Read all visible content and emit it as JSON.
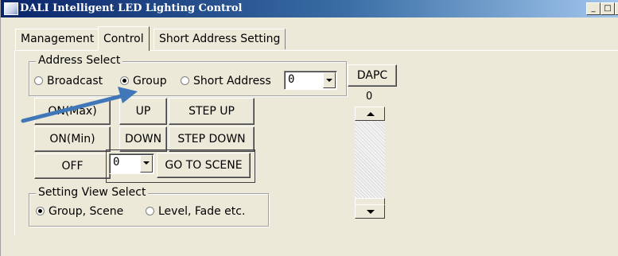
{
  "window": {
    "title": "DALI Intelligent LED Lighting Control",
    "controls": {
      "minimize": "_",
      "maximize": "□",
      "close": "×"
    }
  },
  "tabs": [
    {
      "label": "Management",
      "active": false
    },
    {
      "label": "Control",
      "active": true
    },
    {
      "label": "Short Address Setting",
      "active": false
    }
  ],
  "address_select": {
    "label": "Address Select",
    "options": [
      {
        "label": "Broadcast",
        "selected": false
      },
      {
        "label": "Group",
        "selected": true
      },
      {
        "label": "Short Address",
        "selected": false
      }
    ],
    "short_address_value": "0"
  },
  "dapc": {
    "button_label": "DAPC",
    "value": "0"
  },
  "buttons": {
    "on_max": "ON(Max)",
    "on_min": "ON(Min)",
    "off": "OFF",
    "up": "UP",
    "down": "DOWN",
    "step_up": "STEP UP",
    "step_down": "STEP DOWN",
    "go_to_scene": "GO TO SCENE"
  },
  "scene_select": {
    "value": "0"
  },
  "setting_view": {
    "label": "Setting View Select",
    "options": [
      {
        "label": "Group, Scene",
        "selected": true
      },
      {
        "label": "Level, Fade etc.",
        "selected": false
      }
    ]
  },
  "annotation": {
    "arrow_color": "#3f77b8"
  },
  "colors": {
    "titlebar_start": "#0a246a",
    "face": "#ece9d8"
  }
}
